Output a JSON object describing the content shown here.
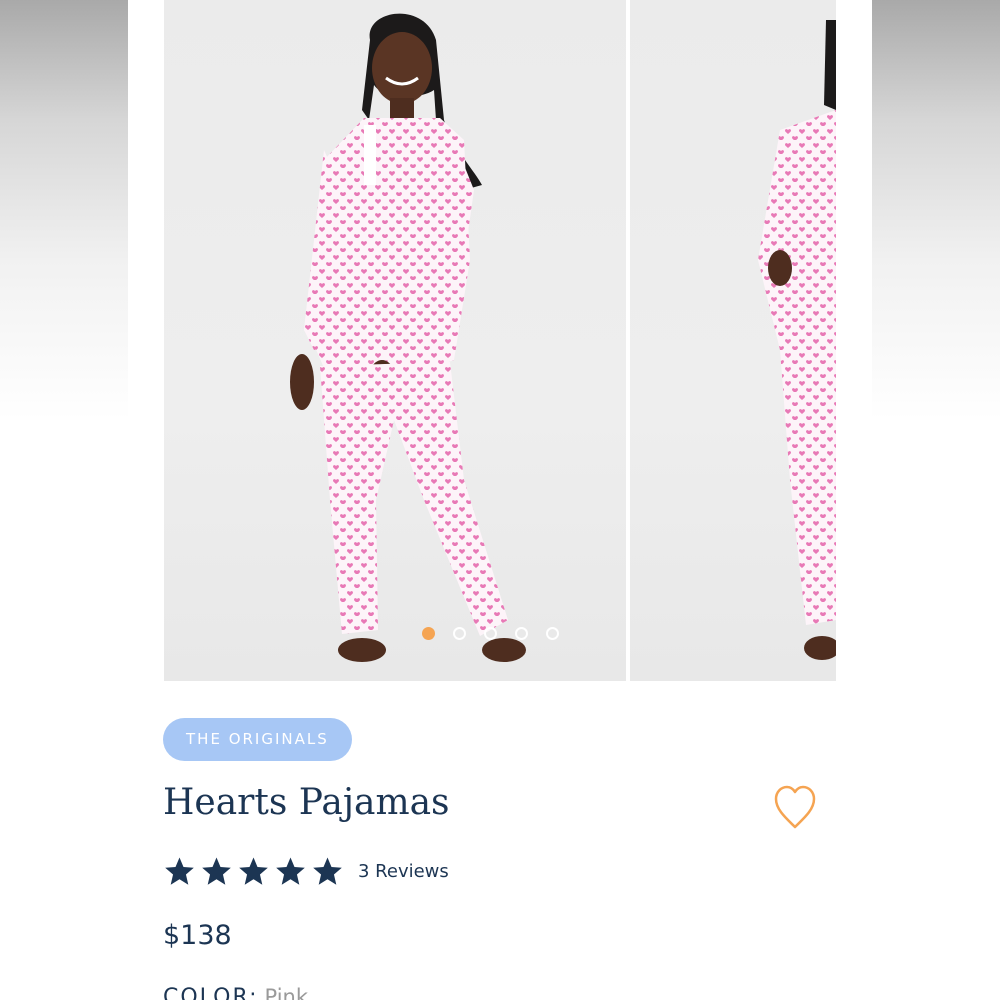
{
  "gallery": {
    "slide_count": 5,
    "active_index": 0
  },
  "product": {
    "badge": "THE ORIGINALS",
    "title": "Hearts Pajamas",
    "rating": 5,
    "reviews_label": "3 Reviews",
    "price": "$138",
    "color_label": "COLOR:",
    "color_value": "Pink"
  },
  "colors": {
    "brand_navy": "#1c3553",
    "badge_blue": "#a7c7f5",
    "accent_orange": "#f5a452",
    "print_pink": "#e879b6"
  },
  "icons": {
    "favorite": "heart-outline-icon",
    "star": "star-filled-icon"
  }
}
